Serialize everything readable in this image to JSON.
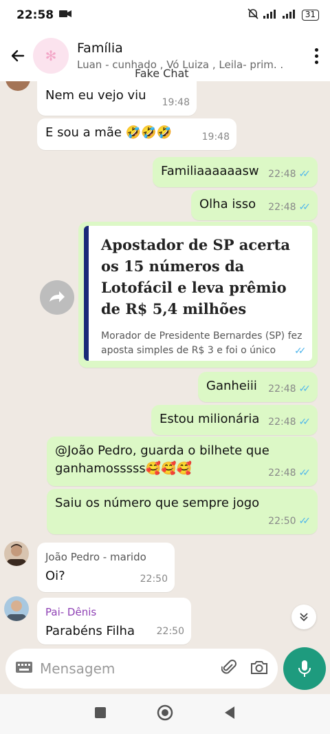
{
  "status": {
    "time": "22:58",
    "battery": "31"
  },
  "header": {
    "title": "Família",
    "members": "Luan - cunhado , Vó Luiza , Leila- prim. .",
    "watermark": "Fake Chat"
  },
  "messages": [
    {
      "text": "Nem eu vejo viu",
      "time": "19:48"
    },
    {
      "text": "E sou a mãe 🤣🤣🤣",
      "time": "19:48"
    },
    {
      "text": "Familiaaaaaasw",
      "time": "22:48"
    },
    {
      "text": "Olha isso",
      "time": "22:48"
    },
    {
      "text": "Ganheiii",
      "time": "22:48"
    },
    {
      "text": "Estou milionária",
      "time": "22:48"
    },
    {
      "text": "@João Pedro, guarda o bilhete que ganhamosssss🥰🥰🥰",
      "time": "22:48"
    },
    {
      "text": "Saiu os número que sempre jogo",
      "time": "22:50"
    },
    {
      "sender": "João Pedro - marido",
      "text": "Oi?",
      "time": "22:50"
    },
    {
      "sender": "Pai- Dênis",
      "text": "Parabéns Filha",
      "time": "22:50"
    }
  ],
  "link": {
    "title": "Apostador de SP acerta os 15 números da Lotofácil e leva prêmio de R$ 5,4 milhões",
    "description": "Morador de Presidente Bernardes (SP) fez aposta simples de R$ 3 e foi o único"
  },
  "input": {
    "placeholder": "Mensagem"
  },
  "colors": {
    "outgoing": "#dcf8c6",
    "incoming": "#ffffff",
    "accent": "#1e9b7e",
    "sender_joao": "#555555",
    "sender_denis": "#8e3fb4",
    "tick": "#4fb6ec"
  }
}
